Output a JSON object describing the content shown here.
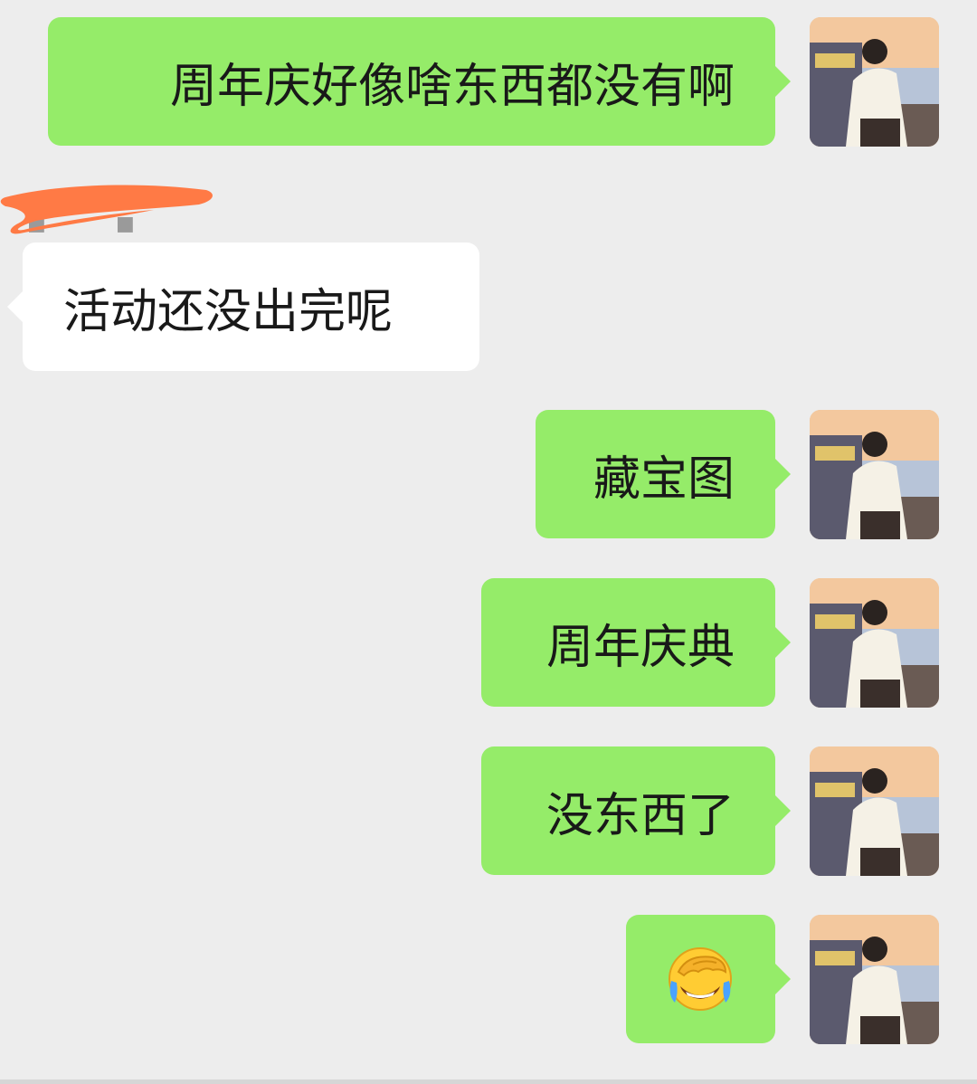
{
  "chat": {
    "messages": [
      {
        "text": "周年庆好像啥东西都没有啊"
      },
      {
        "text": "活动还没出完呢"
      },
      {
        "text": "藏宝图"
      },
      {
        "text": "周年庆典"
      },
      {
        "text": "没东西了"
      },
      {
        "emoji": "facepalm-laughing-emoji"
      }
    ]
  },
  "colors": {
    "background": "#ededed",
    "outgoing_bubble": "#95ec69",
    "incoming_bubble": "#ffffff",
    "redaction": "#ff7a45"
  },
  "icons": {
    "avatar": "avatar-person-by-sea-sunset",
    "redaction": "redacted-sender-name"
  }
}
